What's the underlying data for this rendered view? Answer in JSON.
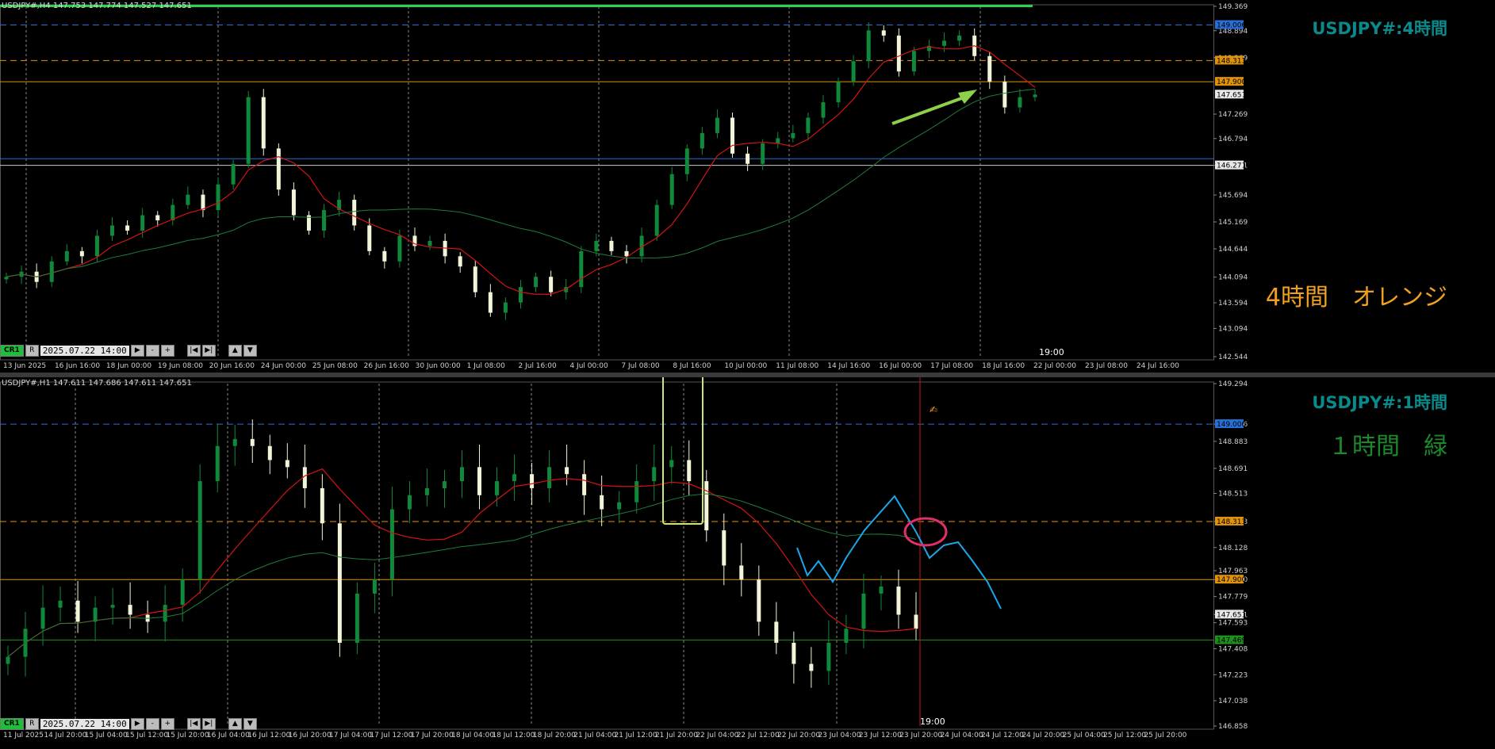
{
  "top": {
    "header": "USDJPY#,H4  147.753 147.774 147.527 147.651",
    "title": "USDJPY#:4時間",
    "note": "4時間　オレンジ",
    "nav": {
      "cr": "CR1",
      "r": "R",
      "date": "2025.07.22 14:00"
    },
    "time_marker": "19:00",
    "price_labels": [
      "149.369",
      "148.894",
      "148.369",
      "147.269",
      "146.794",
      "146.271",
      "145.694",
      "145.169",
      "144.644",
      "144.094",
      "143.594",
      "143.094",
      "142.544"
    ],
    "highlight_labels": {
      "blue": "149.006",
      "orange": "148.313",
      "orange2": "147.900",
      "price": "147.651",
      "line": "146.271"
    },
    "x_labels": [
      "13 Jun 2025",
      "16 Jun 16:00",
      "18 Jun 00:00",
      "19 Jun 08:00",
      "20 Jun 16:00",
      "24 Jun 00:00",
      "25 Jun 08:00",
      "26 Jun 16:00",
      "30 Jun 00:00",
      "1 Jul 08:00",
      "2 Jul 16:00",
      "4 Jul 00:00",
      "7 Jul 08:00",
      "8 Jul 16:00",
      "10 Jul 00:00",
      "11 Jul 08:00",
      "14 Jul 16:00",
      "16 Jul 00:00",
      "17 Jul 08:00",
      "18 Jul 16:00",
      "22 Jul 00:00",
      "23 Jul 08:00",
      "24 Jul 16:00"
    ]
  },
  "bottom": {
    "header": "USDJPY#,H1  147.611 147.686 147.611 147.651",
    "title": "USDJPY#:1時間",
    "note": "１時間　緑",
    "nav": {
      "cr": "CR1",
      "r": "R",
      "date": "2025.07.22 14:00"
    },
    "time_marker": "19:00",
    "price_labels": [
      "149.294",
      "149.006",
      "148.883",
      "148.691",
      "148.513",
      "148.313",
      "148.128",
      "147.963",
      "147.900",
      "147.779",
      "147.651",
      "147.593",
      "147.408",
      "147.223",
      "147.038",
      "146.858"
    ],
    "highlight_labels": {
      "blue": "149.006",
      "orange": "148.313",
      "orange2": "147.900",
      "price": "147.651",
      "green": "147.469"
    },
    "x_labels": [
      "11 Jul 2025",
      "14 Jul 20:00",
      "15 Jul 04:00",
      "15 Jul 12:00",
      "15 Jul 20:00",
      "16 Jul 04:00",
      "16 Jul 12:00",
      "16 Jul 20:00",
      "17 Jul 04:00",
      "17 Jul 12:00",
      "17 Jul 20:00",
      "18 Jul 04:00",
      "18 Jul 12:00",
      "18 Jul 20:00",
      "21 Jul 04:00",
      "21 Jul 12:00",
      "21 Jul 20:00",
      "22 Jul 04:00",
      "22 Jul 12:00",
      "22 Jul 20:00",
      "23 Jul 04:00",
      "23 Jul 12:00",
      "23 Jul 20:00",
      "24 Jul 04:00",
      "24 Jul 12:00",
      "24 Jul 20:00",
      "25 Jul 04:00",
      "25 Jul 12:00",
      "25 Jul 20:00"
    ]
  },
  "colors": {
    "bull": "#0e8a3a",
    "bear": "#f4f4d8",
    "ma_red": "#d21414",
    "ma_green": "#1f7d3c",
    "blue_line": "#2a6fd6",
    "orange_line": "#e0920c",
    "green_line": "#1f8f1f",
    "accent_note_top": "#f0a020",
    "accent_note_bot": "#1a8a2a",
    "arrow": "#8ed04a",
    "box": "#c8e87a",
    "cyan_path": "#1aa8e8",
    "circle": "#e0306a"
  },
  "chart_data": [
    {
      "type": "line",
      "title": "USDJPY#:4時間",
      "ylim": [
        142.544,
        149.369
      ],
      "series": [
        {
          "name": "close",
          "values": [
            144.1,
            144.2,
            144.0,
            144.4,
            144.6,
            144.5,
            144.9,
            145.1,
            145.0,
            145.3,
            145.2,
            145.5,
            145.7,
            145.4,
            145.9,
            146.3,
            147.6,
            146.6,
            145.8,
            145.3,
            145.0,
            145.4,
            145.6,
            145.1,
            144.6,
            144.4,
            144.9,
            144.7,
            144.8,
            144.5,
            144.3,
            143.8,
            143.4,
            143.6,
            143.9,
            144.1,
            143.8,
            143.9,
            144.6,
            144.8,
            144.6,
            144.5,
            144.9,
            145.5,
            146.1,
            146.6,
            146.9,
            147.2,
            146.5,
            146.3,
            146.7,
            146.8,
            146.9,
            147.2,
            147.5,
            147.9,
            148.3,
            148.9,
            148.8,
            148.1,
            148.5,
            148.6,
            148.7,
            148.8,
            148.4,
            147.9,
            147.4,
            147.6,
            147.65
          ]
        }
      ]
    },
    {
      "type": "line",
      "title": "USDJPY#:1時間",
      "ylim": [
        146.858,
        149.294
      ],
      "series": [
        {
          "name": "close",
          "values": [
            147.35,
            147.55,
            147.7,
            147.75,
            147.6,
            147.7,
            147.72,
            147.65,
            147.6,
            147.72,
            147.9,
            148.6,
            148.85,
            148.9,
            148.85,
            148.75,
            148.7,
            148.55,
            148.3,
            147.45,
            147.8,
            147.9,
            148.4,
            148.5,
            148.55,
            148.6,
            148.7,
            148.5,
            148.6,
            148.65,
            148.55,
            148.7,
            148.65,
            148.5,
            148.4,
            148.45,
            148.6,
            148.7,
            148.75,
            148.6,
            148.25,
            148.0,
            147.9,
            147.6,
            147.45,
            147.3,
            147.25,
            147.45,
            147.55,
            147.8,
            147.85,
            147.65,
            147.55
          ]
        }
      ]
    }
  ]
}
